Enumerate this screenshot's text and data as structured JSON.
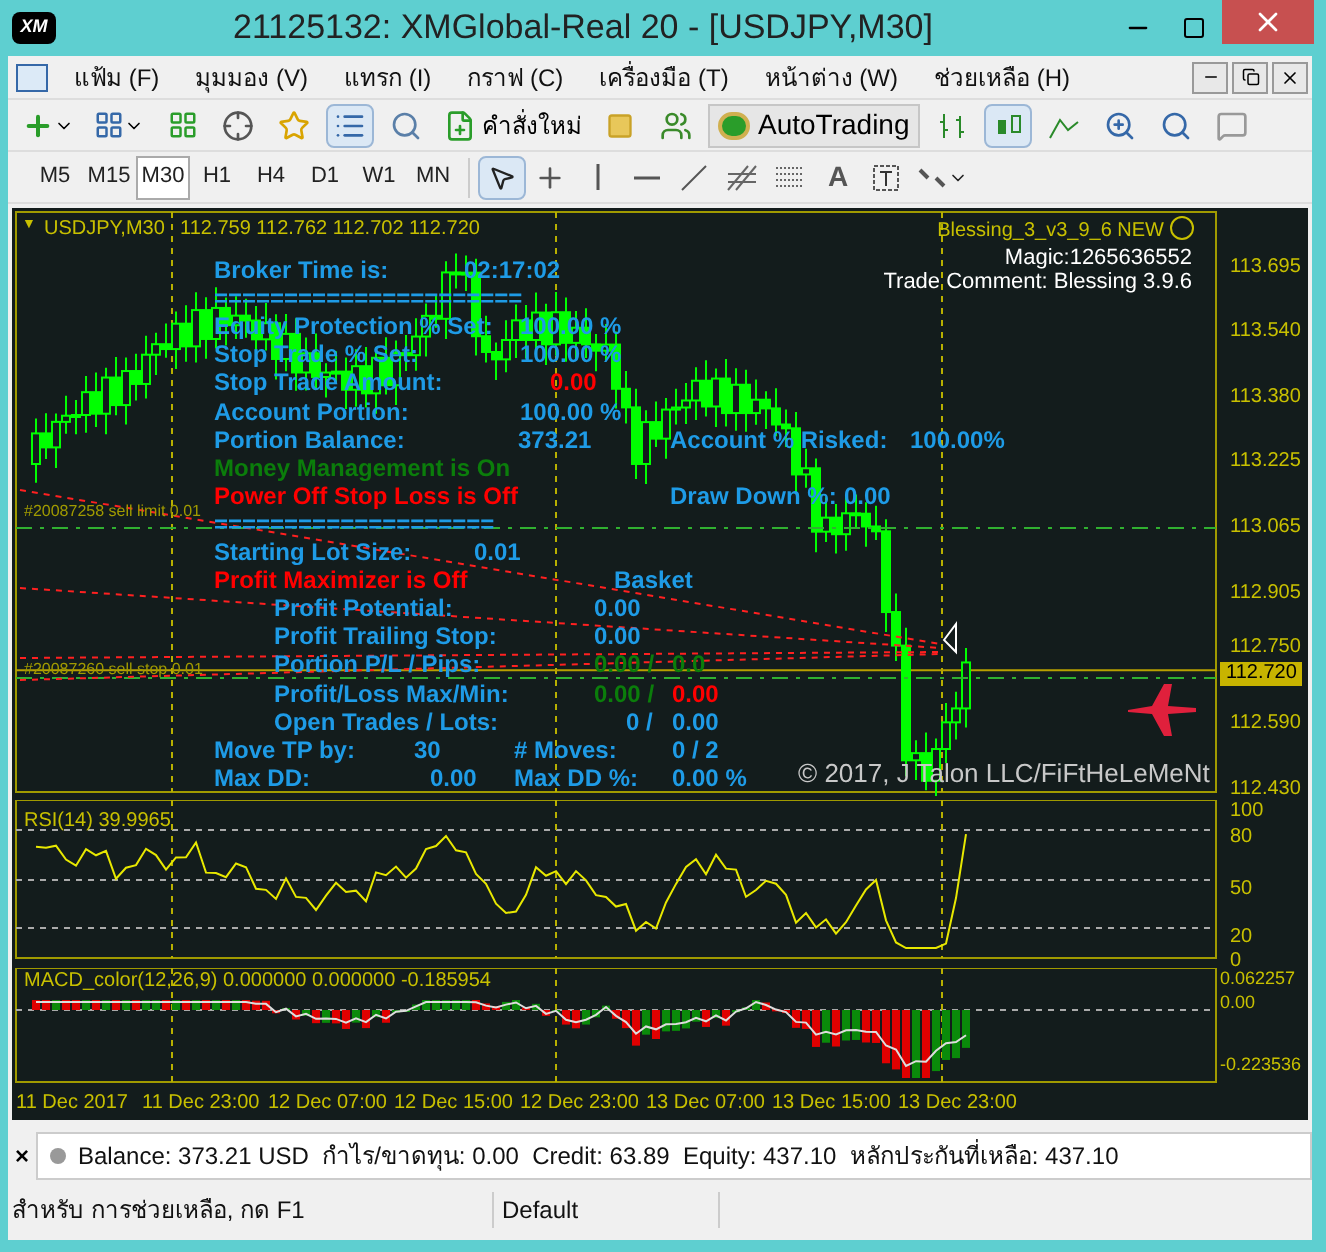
{
  "window": {
    "title": "21125132: XMGlobal-Real 20 - [USDJPY,M30]",
    "logo": "XM"
  },
  "menu": [
    {
      "label": "แฟ้ม (F)"
    },
    {
      "label": "มุมมอง (V)"
    },
    {
      "label": "แทรก (I)"
    },
    {
      "label": "กราฟ (C)"
    },
    {
      "label": "เครื่องมือ (T)"
    },
    {
      "label": "หน้าต่าง (W)"
    },
    {
      "label": "ช่วยเหลือ (H)"
    }
  ],
  "toolbar": {
    "new_order": "คำสั่งใหม่",
    "autotrading": "AutoTrading"
  },
  "timeframes": [
    {
      "label": "M5",
      "selected": false
    },
    {
      "label": "M15",
      "selected": false
    },
    {
      "label": "M30",
      "selected": true
    },
    {
      "label": "H1",
      "selected": false
    },
    {
      "label": "H4",
      "selected": false
    },
    {
      "label": "D1",
      "selected": false
    },
    {
      "label": "W1",
      "selected": false
    },
    {
      "label": "MN",
      "selected": false
    }
  ],
  "draw_tools": {
    "text_tool": "A"
  },
  "chart": {
    "marker": "▼",
    "symbol": "USDJPY,M30",
    "quote": "112.759 112.762 112.702 112.720",
    "ea_name": "Blessing_3_v3_9_6 NEW",
    "magic": "Magic:1265636552",
    "trade_comment": "Trade Comment: Blessing 3.9.6",
    "current_price": "112.720",
    "copyright": "© 2017, J Talon LLC/FiFtHeLeMeNt",
    "price_axis": [
      "113.695",
      "113.540",
      "113.380",
      "113.225",
      "113.065",
      "112.905",
      "112.750",
      "112.590",
      "112.430"
    ],
    "orders": [
      "#20087258 sell limit 0.01",
      "#20087260 sell stop 0.01"
    ],
    "ea_lines": [
      {
        "cells": [
          {
            "text": "Broker Time is:",
            "color": "#1e9be6"
          },
          {
            "text": "02:17:02",
            "color": "#1e9be6"
          }
        ]
      },
      {
        "cells": [
          {
            "text": "======================",
            "color": "#1e9be6"
          }
        ]
      },
      {
        "cells": [
          {
            "text": "Equity Protection % Set:",
            "color": "#1e9be6"
          },
          {
            "text": "100.00 %",
            "color": "#1e9be6"
          }
        ]
      },
      {
        "cells": [
          {
            "text": "Stop Trade % Set:",
            "color": "#1e9be6"
          },
          {
            "text": "100.00 %",
            "color": "#1e9be6"
          }
        ]
      },
      {
        "cells": [
          {
            "text": "Stop Trade Amount:",
            "color": "#1e9be6"
          },
          {
            "text": "0.00",
            "color": "#ff0000"
          }
        ]
      },
      {
        "cells": [
          {
            "text": "Account Portion:",
            "color": "#1e9be6"
          },
          {
            "text": "100.00 %",
            "color": "#1e9be6"
          }
        ]
      },
      {
        "cells": [
          {
            "text": "Portion Balance:",
            "color": "#1e9be6"
          },
          {
            "text": "373.21",
            "color": "#1e9be6"
          },
          {
            "text": "Account % Risked:",
            "color": "#1e9be6"
          },
          {
            "text": "100.00%",
            "color": "#1e9be6"
          }
        ]
      },
      {
        "cells": [
          {
            "text": "Money Management is On",
            "color": "#0b7d0b"
          }
        ]
      },
      {
        "cells": [
          {
            "text": "Power Off Stop Loss is Off",
            "color": "#ff0000"
          },
          {
            "text": "Draw Down %:",
            "color": "#1e9be6"
          },
          {
            "text": "0.00",
            "color": "#1e9be6"
          }
        ]
      },
      {
        "cells": [
          {
            "text": "====================",
            "color": "#1e9be6"
          }
        ]
      },
      {
        "cells": [
          {
            "text": "Starting Lot Size:",
            "color": "#1e9be6"
          },
          {
            "text": "0.01",
            "color": "#1e9be6"
          }
        ]
      },
      {
        "cells": [
          {
            "text": "Profit Maximizer is Off",
            "color": "#ff0000"
          },
          {
            "text": "Basket",
            "color": "#1e9be6"
          }
        ]
      },
      {
        "cells": [
          {
            "text": "Profit Potential:",
            "color": "#1e9be6"
          },
          {
            "text": "0.00",
            "color": "#1e9be6"
          }
        ]
      },
      {
        "cells": [
          {
            "text": "Profit Trailing Stop:",
            "color": "#1e9be6"
          },
          {
            "text": "0.00",
            "color": "#1e9be6"
          }
        ]
      },
      {
        "cells": [
          {
            "text": "Portion P/L / Pips:",
            "color": "#1e9be6"
          },
          {
            "text": "0.00  /",
            "color": "#0b7d0b"
          },
          {
            "text": "0.0",
            "color": "#0b7d0b"
          }
        ]
      },
      {
        "cells": [
          {
            "text": "Profit/Loss Max/Min:",
            "color": "#1e9be6"
          },
          {
            "text": "0.00  /",
            "color": "#0b7d0b"
          },
          {
            "text": "0.00",
            "color": "#ff0000"
          }
        ]
      },
      {
        "cells": [
          {
            "text": "Open Trades / Lots:",
            "color": "#1e9be6"
          },
          {
            "text": "0  /",
            "color": "#1e9be6"
          },
          {
            "text": "0.00",
            "color": "#1e9be6"
          }
        ]
      },
      {
        "cells": [
          {
            "text": "Move TP by:",
            "color": "#1e9be6"
          },
          {
            "text": "30",
            "color": "#1e9be6"
          },
          {
            "text": "# Moves:",
            "color": "#1e9be6"
          },
          {
            "text": "0 / 2",
            "color": "#1e9be6"
          }
        ]
      },
      {
        "cells": [
          {
            "text": "Max DD:",
            "color": "#1e9be6"
          },
          {
            "text": "0.00",
            "color": "#1e9be6"
          },
          {
            "text": "Max DD %:",
            "color": "#1e9be6"
          },
          {
            "text": "0.00 %",
            "color": "#1e9be6"
          }
        ]
      }
    ]
  },
  "rsi": {
    "header": "RSI(14) 39.9965",
    "axis": [
      "100",
      "80",
      "50",
      "20",
      "0"
    ]
  },
  "macd": {
    "header": "MACD_color(12,26,9) 0.000000 0.000000 -0.185954",
    "axis": [
      "0.062257",
      "0.00",
      "-0.223536"
    ]
  },
  "time_axis": [
    "11 Dec 2017",
    "11 Dec 23:00",
    "12 Dec 07:00",
    "12 Dec 15:00",
    "12 Dec 23:00",
    "13 Dec 07:00",
    "13 Dec 15:00",
    "13 Dec 23:00"
  ],
  "terminal": {
    "close": "×",
    "summary": "Balance: 373.21 USD  กำไร/ขาดทุน: 0.00  Credit: 63.89  Equity: 437.10  หลักประกันที่เหลือ: 437.10"
  },
  "status_bar": {
    "help": "สำหรับ การช่วยเหลือ, กด F1",
    "profile": "Default"
  }
}
